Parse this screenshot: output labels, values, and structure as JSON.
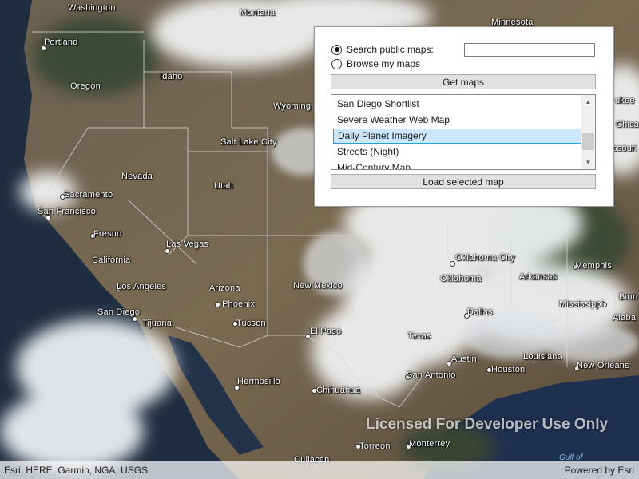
{
  "map": {
    "labels": [
      {
        "text": "Washington"
      },
      {
        "text": "Montana"
      },
      {
        "text": "Minnesota"
      },
      {
        "text": "Portland"
      },
      {
        "text": "Oregon"
      },
      {
        "text": "Idaho"
      },
      {
        "text": "Wyoming"
      },
      {
        "text": "Salt Lake City"
      },
      {
        "text": "Nevada"
      },
      {
        "text": "Utah"
      },
      {
        "text": "Sacramento"
      },
      {
        "text": "San Francisco"
      },
      {
        "text": "Fresno"
      },
      {
        "text": "California"
      },
      {
        "text": "Las Vegas"
      },
      {
        "text": "Los Angeles"
      },
      {
        "text": "Arizona"
      },
      {
        "text": "Phoenix"
      },
      {
        "text": "San Diego"
      },
      {
        "text": "Tijuana"
      },
      {
        "text": "Tucson"
      },
      {
        "text": "New Mexico"
      },
      {
        "text": "El Paso"
      },
      {
        "text": "Hermosillo"
      },
      {
        "text": "Chihuahua"
      },
      {
        "text": "Torreon"
      },
      {
        "text": "Monterrey"
      },
      {
        "text": "Culiacan"
      },
      {
        "text": "Oklahoma City"
      },
      {
        "text": "Oklahoma"
      },
      {
        "text": "Arkansas"
      },
      {
        "text": "Memphis"
      },
      {
        "text": "Mississippi"
      },
      {
        "text": "Dallas"
      },
      {
        "text": "Texas"
      },
      {
        "text": "Austin"
      },
      {
        "text": "Houston"
      },
      {
        "text": "Louisiana"
      },
      {
        "text": "New Orleans"
      },
      {
        "text": "San Antonio"
      },
      {
        "text": "Missouri"
      },
      {
        "text": "Chica"
      },
      {
        "text": "ukee"
      },
      {
        "text": "Birm"
      },
      {
        "text": "Alaba"
      }
    ],
    "watermark": "Licensed For Developer Use Only",
    "gulf": "Gulf of"
  },
  "attribution": {
    "left": "Esri, HERE, Garmin, NGA, USGS",
    "right": "Powered by Esri"
  },
  "panel": {
    "radio_search_label": "Search public maps:",
    "radio_browse_label": "Browse my maps",
    "search_value": "",
    "get_maps_label": "Get maps",
    "load_label": "Load selected map",
    "list_items": [
      {
        "label": "San Diego Shortlist"
      },
      {
        "label": "Severe Weather Web Map"
      },
      {
        "label": "Daily Planet Imagery"
      },
      {
        "label": "Streets (Night)"
      },
      {
        "label": "Mid-Century Map"
      }
    ],
    "selected_item": "Daily Planet Imagery"
  }
}
